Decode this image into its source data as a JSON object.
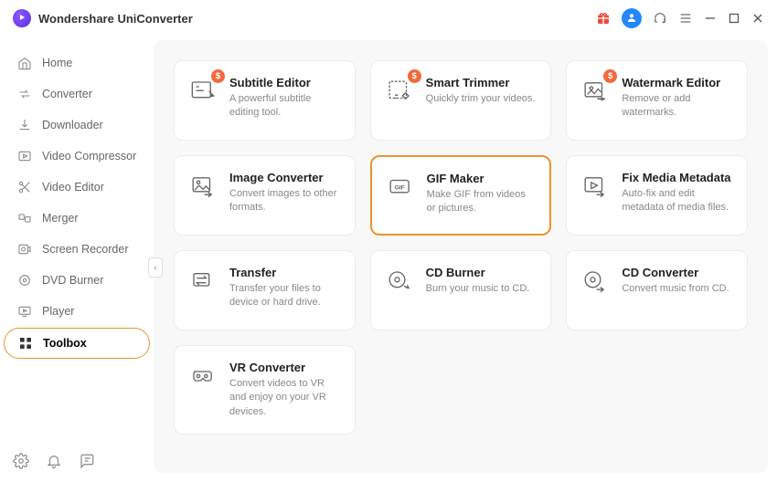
{
  "app": {
    "title": "Wondershare UniConverter"
  },
  "sidebar": {
    "items": [
      {
        "label": "Home"
      },
      {
        "label": "Converter"
      },
      {
        "label": "Downloader"
      },
      {
        "label": "Video Compressor"
      },
      {
        "label": "Video Editor"
      },
      {
        "label": "Merger"
      },
      {
        "label": "Screen Recorder"
      },
      {
        "label": "DVD Burner"
      },
      {
        "label": "Player"
      },
      {
        "label": "Toolbox"
      }
    ]
  },
  "tools": [
    {
      "title": "Subtitle Editor",
      "desc": "A powerful subtitle editing tool.",
      "badge": "$"
    },
    {
      "title": "Smart Trimmer",
      "desc": "Quickly trim your videos.",
      "badge": "$"
    },
    {
      "title": "Watermark Editor",
      "desc": "Remove or add watermarks.",
      "badge": "$"
    },
    {
      "title": "Image Converter",
      "desc": "Convert images to other formats."
    },
    {
      "title": "GIF Maker",
      "desc": "Make GIF from videos or pictures."
    },
    {
      "title": "Fix Media Metadata",
      "desc": "Auto-fix and edit metadata of media files."
    },
    {
      "title": "Transfer",
      "desc": "Transfer your files to device or hard drive."
    },
    {
      "title": "CD Burner",
      "desc": "Burn your music to CD."
    },
    {
      "title": "CD Converter",
      "desc": "Convert music from CD."
    },
    {
      "title": "VR Converter",
      "desc": "Convert videos to VR and enjoy on your VR devices."
    }
  ]
}
